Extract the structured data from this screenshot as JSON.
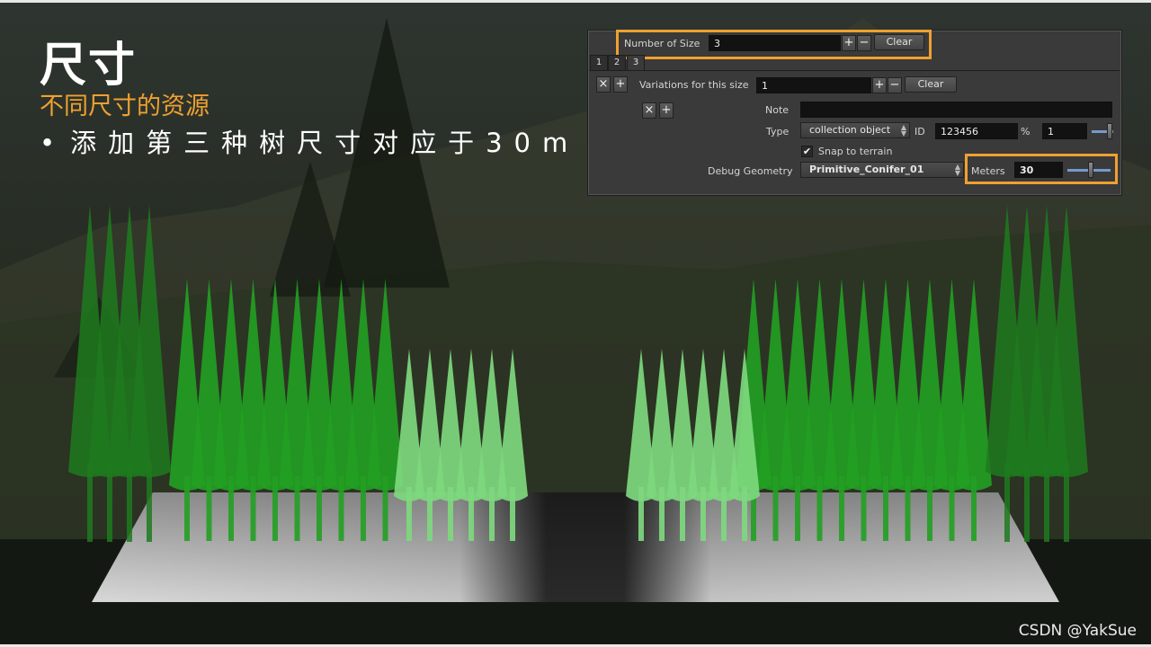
{
  "slide": {
    "title": "尺寸",
    "subtitle": "不同尺寸的资源",
    "bullet_marker": "•",
    "bullet_text": "添加第三种树尺寸对应于30m"
  },
  "panel": {
    "number_of_size": {
      "label": "Number of Size",
      "value": "3",
      "plus": "+",
      "minus": "−",
      "clear_label": "Clear"
    },
    "tabs": [
      "1",
      "2",
      "3"
    ],
    "active_tab": "3",
    "variations": {
      "remove": "×",
      "add": "+",
      "label": "Variations for this size",
      "value": "1",
      "plus": "+",
      "minus": "−",
      "clear_label": "Clear"
    },
    "variation_row": {
      "remove": "×",
      "add": "+"
    },
    "note": {
      "label": "Note",
      "value": ""
    },
    "type": {
      "label": "Type",
      "value": "collection object",
      "id_label": "ID",
      "id_value": "123456",
      "percent_label": "%",
      "percent_value": "1",
      "percent_slider_level": 0.95
    },
    "snap": {
      "label": "Snap to terrain",
      "checked": true,
      "check_glyph": "✔"
    },
    "debug_geometry": {
      "label": "Debug Geometry",
      "value": "Primitive_Conifer_01"
    },
    "meters": {
      "label": "Meters",
      "value": "30",
      "slider_level": 0.55
    }
  },
  "colors": {
    "accent": "#f0a030",
    "tree_large": "#1e7a1e",
    "tree_medium": "#22a022",
    "tree_small": "#7ed87e"
  },
  "watermark": "CSDN @YakSue"
}
